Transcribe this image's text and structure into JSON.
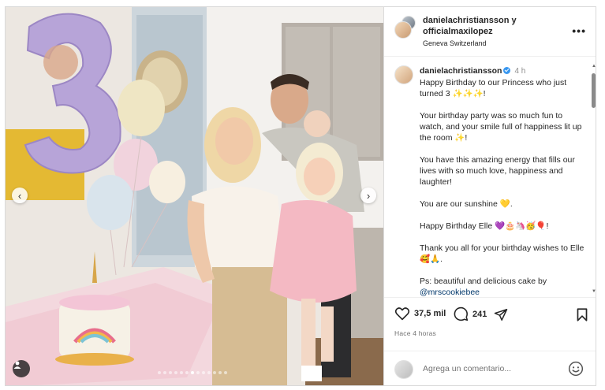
{
  "post": {
    "header": {
      "users": "danielachristiansson y officialmaxilopez",
      "location": "Geneva Switzerland",
      "more_label": "•••"
    },
    "caption": {
      "username": "danielachristiansson",
      "time": "4 h",
      "line1": "Happy Birthday to our Princess who just turned 3 ✨✨✨!",
      "line2": "Your birthday party was so much fun to watch, and your smile full of happiness lit up the room ✨!",
      "line3": "You have this amazing energy that fills our lives with so much love, happiness and laughter!",
      "line4": "You are our sunshine 💛.",
      "line5": "Happy Birthday Elle 💜🎂🦄🥳🎈!",
      "line6": "Thank you all for your birthday wishes to Elle 🥰🙏.",
      "line7": "Ps: beautiful and delicious cake by",
      "mention": "@mrscookiebee"
    },
    "stats": {
      "likes": "37,5 mil",
      "comments": "241"
    },
    "timestamp": "Hace 4 horas",
    "comment_box": {
      "placeholder": "Agrega un comentario..."
    },
    "carousel": {
      "total_slides": 13,
      "active_index": 6
    }
  },
  "colors": {
    "verified": "#3897f0",
    "mention": "#00376b",
    "muted": "#737373"
  }
}
